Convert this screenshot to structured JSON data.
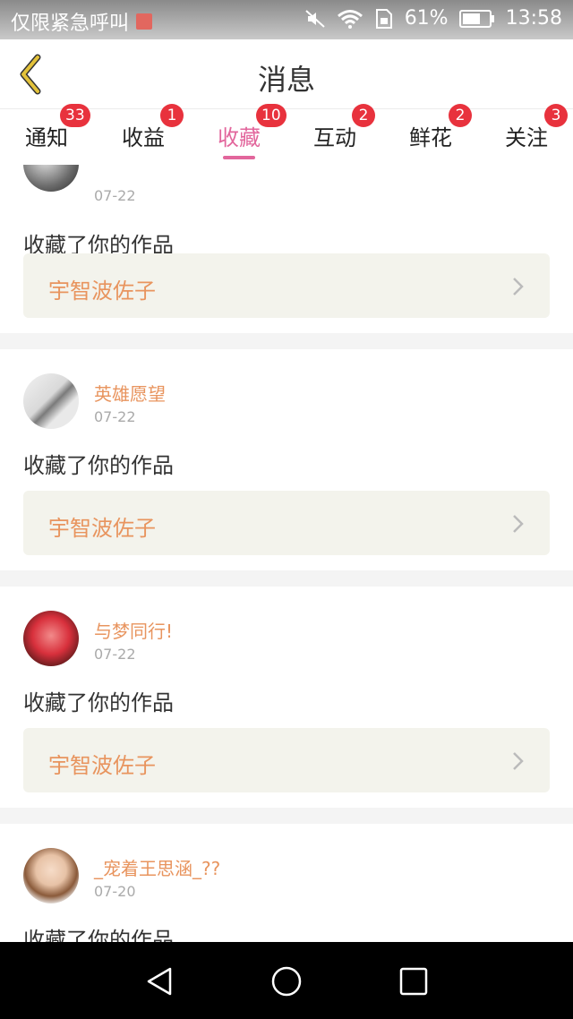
{
  "status_bar": {
    "carrier": "仅限紧急呼叫",
    "battery_percent": "61%",
    "time": "13:58"
  },
  "header": {
    "title": "消息"
  },
  "tabs": [
    {
      "label": "通知",
      "badge": "33",
      "active": false
    },
    {
      "label": "收益",
      "badge": "1",
      "active": false
    },
    {
      "label": "收藏",
      "badge": "10",
      "active": true
    },
    {
      "label": "互动",
      "badge": "2",
      "active": false
    },
    {
      "label": "鲜花",
      "badge": "2",
      "active": false
    },
    {
      "label": "关注",
      "badge": "3",
      "active": false
    }
  ],
  "messages": [
    {
      "user": "",
      "time": "07-22",
      "text": "收藏了你的作品",
      "work": "宇智波佐子"
    },
    {
      "user": "英雄愿望",
      "time": "07-22",
      "text": "收藏了你的作品",
      "work": "宇智波佐子"
    },
    {
      "user": "与梦同行!",
      "time": "07-22",
      "text": "收藏了你的作品",
      "work": "宇智波佐子"
    },
    {
      "user": "_宠着王思涵_??",
      "time": "07-20",
      "text": "收藏了你的作品",
      "work": ""
    }
  ],
  "colors": {
    "accent": "#e2669c",
    "badge": "#e8323d",
    "username": "#e8945e",
    "back_arrow": "#e3c23a"
  },
  "icons": {
    "back": "chevron-left-icon",
    "work_link": "chevron-right-icon",
    "nav": [
      "back-triangle-icon",
      "home-circle-icon",
      "recents-square-icon"
    ]
  }
}
